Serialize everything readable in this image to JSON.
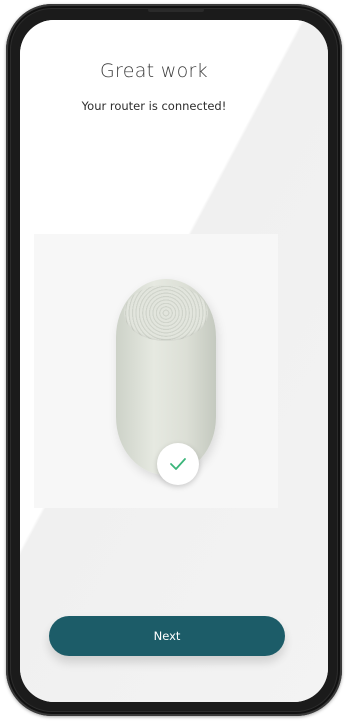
{
  "header": {
    "title": "Great work",
    "subtitle": "Your router is connected!"
  },
  "device": {
    "status_icon": "checkmark-icon",
    "status_color": "#3bb57a"
  },
  "footer": {
    "next_label": "Next"
  },
  "colors": {
    "primary_button": "#1c5c68",
    "button_text": "#ffffff",
    "background": "#f6f6f6",
    "title_text": "#3c3c3c"
  }
}
